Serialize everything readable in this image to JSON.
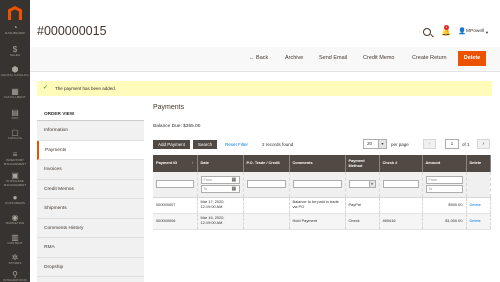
{
  "nav": {
    "items": [
      {
        "icon": "dashboard-icon",
        "glyph": "◔",
        "label": "Dashboard"
      },
      {
        "icon": "dollar-icon",
        "glyph": "$",
        "label": "Sales"
      },
      {
        "icon": "cube-icon",
        "glyph": "⬢",
        "label": "Digital Catalog"
      },
      {
        "icon": "grid-icon",
        "glyph": "▦",
        "label": "Fulfillment"
      },
      {
        "icon": "store-icon",
        "glyph": "▤",
        "label": "POS"
      },
      {
        "icon": "shop-icon",
        "glyph": "▢",
        "label": "Catalog"
      },
      {
        "icon": "bars-icon",
        "glyph": "≡",
        "label": "Inventory Management"
      },
      {
        "icon": "cart-icon",
        "glyph": "▣",
        "label": "Purchase Management"
      },
      {
        "icon": "person-icon",
        "glyph": "●",
        "label": "Customers"
      },
      {
        "icon": "eye-icon",
        "glyph": "◉",
        "label": "Marketing"
      },
      {
        "icon": "pages-icon",
        "glyph": "▥",
        "label": "Content"
      },
      {
        "icon": "gear-icon",
        "glyph": "✲",
        "label": "Stores"
      },
      {
        "icon": "link-icon",
        "glyph": "⚲",
        "label": "Integrations"
      }
    ]
  },
  "header": {
    "title": "#000000015",
    "notifications_count": "1",
    "user": "MPowell"
  },
  "actions": {
    "back": "Back",
    "archive": "Archive",
    "send_email": "Send Email",
    "credit_memo": "Credit Memo",
    "create_return": "Create Return",
    "delete": "Delete"
  },
  "message": "The payment has been added.",
  "order_view": {
    "title": "Order View",
    "items": [
      "Information",
      "Payments",
      "Invoices",
      "Credit Memos",
      "Shipments",
      "Comments History",
      "RMA",
      "Dropship"
    ],
    "active": "Payments"
  },
  "payments": {
    "title": "Payments",
    "balance_due": "Balance Due: $355.00",
    "add_payment": "Add Payment",
    "search": "Search",
    "reset_filter": "Reset Filter",
    "records_found": "2 records found",
    "per_page_value": "20",
    "per_page_label": "per page",
    "page_current": "1",
    "page_of": "of 1",
    "columns": [
      "Payment ID",
      "Date",
      "P.O. Trade / Credit",
      "Comments",
      "Payment Method",
      "Check #",
      "Amount",
      "Delete"
    ],
    "filter_placeholders": {
      "from": "From",
      "to": "To"
    },
    "rows": [
      {
        "id": "000000007",
        "date": "Mar 17, 2020, 12:19:00 AM",
        "po": "",
        "comments": "Balance to be paid in trade via PO",
        "method": "PayPal",
        "check": "",
        "amount": "$900.00",
        "delete": "Delete"
      },
      {
        "id": "000000006",
        "date": "Mar 16, 2020, 12:19:00 AM",
        "po": "",
        "comments": "Hold Payment",
        "method": "Check",
        "check": "465416",
        "amount": "$1,000.00",
        "delete": "Delete"
      }
    ]
  }
}
